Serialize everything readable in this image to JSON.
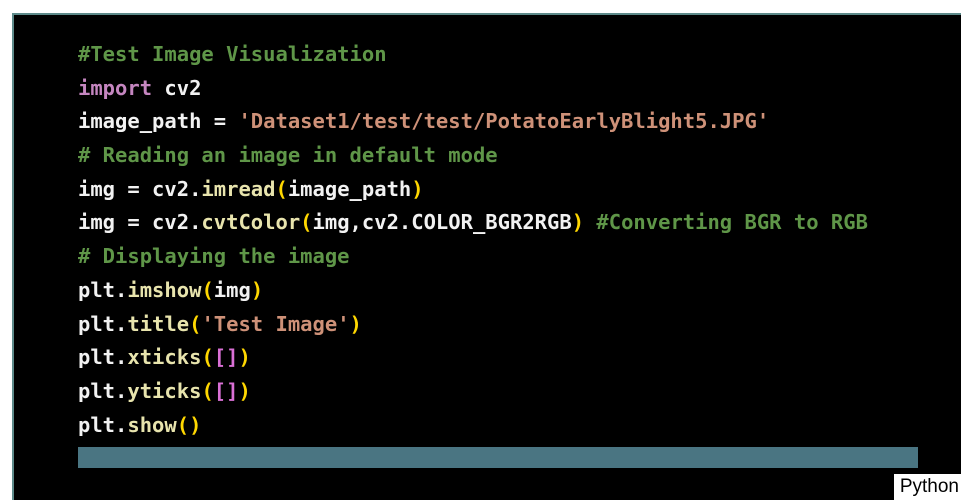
{
  "editor": {
    "language_label": "Python",
    "lines": [
      [
        {
          "t": "comment",
          "v": "#Test Image Visualization"
        }
      ],
      [
        {
          "t": "keyword",
          "v": "import"
        },
        {
          "t": "text",
          "v": " cv2"
        }
      ],
      [
        {
          "t": "text",
          "v": "image_path = "
        },
        {
          "t": "string",
          "v": "'Dataset1/test/test/PotatoEarlyBlight5.JPG'"
        }
      ],
      [
        {
          "t": "comment",
          "v": "# Reading an image in default mode"
        }
      ],
      [
        {
          "t": "text",
          "v": "img = cv2."
        },
        {
          "t": "func",
          "v": "imread"
        },
        {
          "t": "paren",
          "v": "("
        },
        {
          "t": "text",
          "v": "image_path"
        },
        {
          "t": "paren",
          "v": ")"
        }
      ],
      [
        {
          "t": "text",
          "v": "img = cv2."
        },
        {
          "t": "func",
          "v": "cvtColor"
        },
        {
          "t": "paren",
          "v": "("
        },
        {
          "t": "text",
          "v": "img,cv2.COLOR_BGR2RGB"
        },
        {
          "t": "paren",
          "v": ")"
        },
        {
          "t": "text",
          "v": " "
        },
        {
          "t": "comment",
          "v": "#Converting BGR to RGB"
        }
      ],
      [
        {
          "t": "comment",
          "v": "# Displaying the image"
        }
      ],
      [
        {
          "t": "text",
          "v": "plt."
        },
        {
          "t": "func",
          "v": "imshow"
        },
        {
          "t": "paren",
          "v": "("
        },
        {
          "t": "text",
          "v": "img"
        },
        {
          "t": "paren",
          "v": ")"
        }
      ],
      [
        {
          "t": "text",
          "v": "plt."
        },
        {
          "t": "func",
          "v": "title"
        },
        {
          "t": "paren",
          "v": "("
        },
        {
          "t": "string",
          "v": "'Test Image'"
        },
        {
          "t": "paren",
          "v": ")"
        }
      ],
      [
        {
          "t": "text",
          "v": "plt."
        },
        {
          "t": "func",
          "v": "xticks"
        },
        {
          "t": "paren",
          "v": "("
        },
        {
          "t": "bracket",
          "v": "[]"
        },
        {
          "t": "paren",
          "v": ")"
        }
      ],
      [
        {
          "t": "text",
          "v": "plt."
        },
        {
          "t": "func",
          "v": "yticks"
        },
        {
          "t": "paren",
          "v": "("
        },
        {
          "t": "bracket",
          "v": "[]"
        },
        {
          "t": "paren",
          "v": ")"
        }
      ],
      [
        {
          "t": "text",
          "v": "plt."
        },
        {
          "t": "func",
          "v": "show"
        },
        {
          "t": "paren",
          "v": "()"
        }
      ]
    ]
  },
  "colors": {
    "background": "#000000",
    "comment": "#5f9648",
    "keyword": "#c586c0",
    "text": "#f2f2f2",
    "string": "#ce9178",
    "function": "#e8e4ad",
    "paren": "#ffd700",
    "bracket": "#da70d6",
    "scrollbar": "#4a7582",
    "border": "#5d8a8a"
  }
}
